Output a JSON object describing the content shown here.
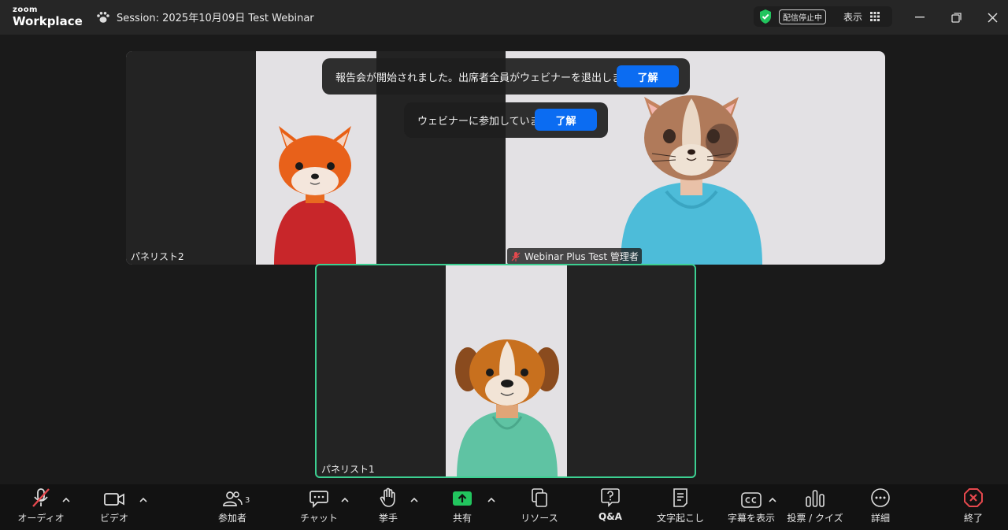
{
  "app": {
    "logo_top": "zoom",
    "logo_bottom": "Workplace"
  },
  "session": {
    "title": "Session: 2025年10月09日 Test Webinar"
  },
  "status": {
    "badge": "配信停止中",
    "view_label": "表示"
  },
  "toasts": [
    {
      "message": "報告会が開始されました。出席者全員がウェビナーを退出しました。",
      "button": "了解"
    },
    {
      "message": "ウェビナーに参加しています",
      "button": "了解"
    }
  ],
  "videos": [
    {
      "name": "パネリスト2"
    },
    {
      "name": "Webinar Plus Test 管理者"
    },
    {
      "name": "パネリスト1"
    }
  ],
  "toolbar": {
    "audio": "オーディオ",
    "video": "ビデオ",
    "participants": "参加者",
    "participants_count": "3",
    "chat": "チャット",
    "raise_hand": "挙手",
    "share": "共有",
    "resources": "リソース",
    "qa": "Q&A",
    "transcript": "文字起こし",
    "captions": "字幕を表示",
    "polls": "投票 / クイズ",
    "more": "詳細",
    "end": "終了"
  },
  "colors": {
    "accent_blue": "#0b6cf2",
    "active_speaker": "#3ccf91",
    "share_green": "#22c55e",
    "end_red": "#e5484d",
    "shield_green": "#22c55e"
  }
}
